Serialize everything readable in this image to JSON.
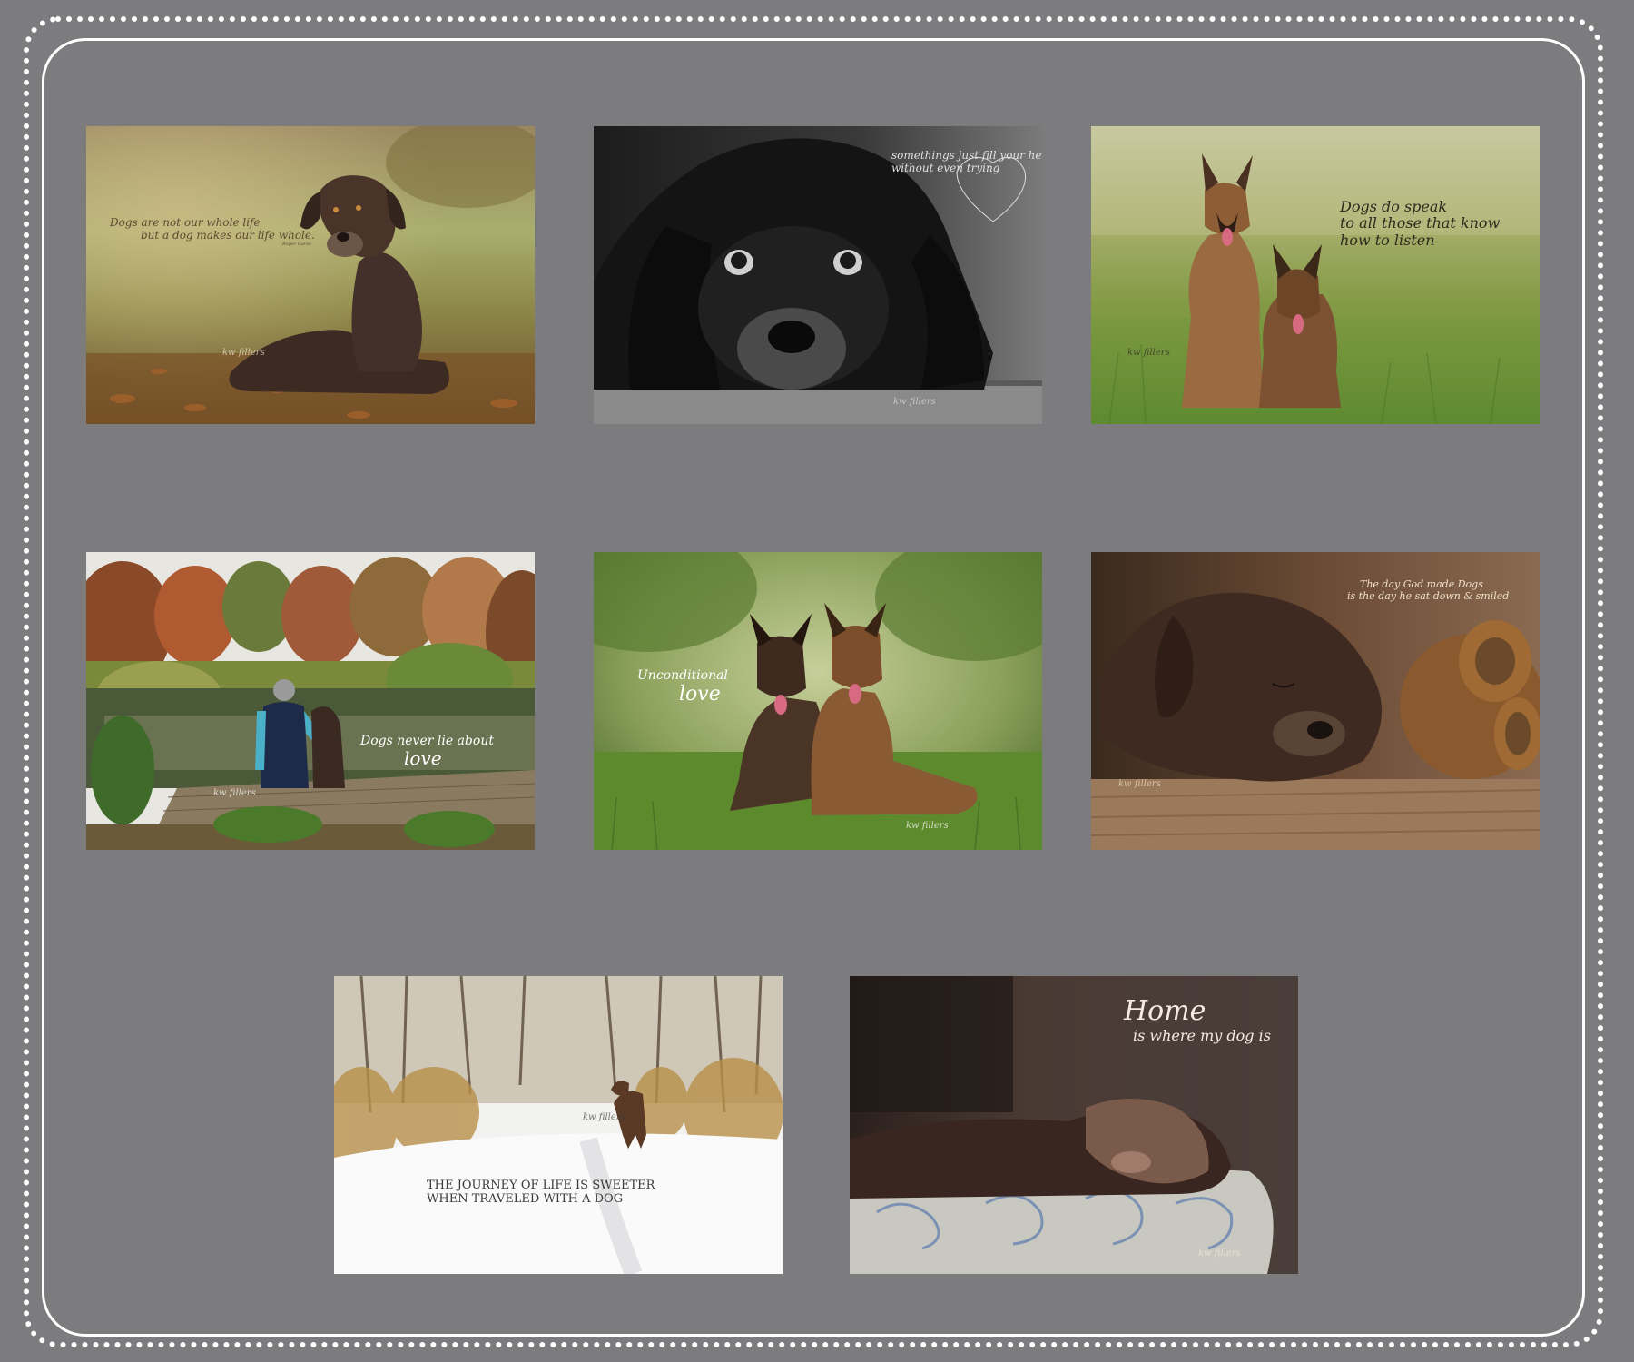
{
  "photos": [
    {
      "id": "labrador-autumn",
      "quote_lines": [
        "Dogs are not our whole life",
        "but a dog makes our life whole."
      ],
      "attribution": "Roger Caras",
      "watermark": "kw fillers"
    },
    {
      "id": "black-spaniel-bw",
      "quote_lines": [
        "somethings just fill your heart",
        "without even trying"
      ],
      "watermark": "kw fillers"
    },
    {
      "id": "two-malinois-field",
      "quote_lines": [
        "Dogs do speak",
        "to all those that know",
        "how to listen"
      ],
      "watermark": "kw fillers"
    },
    {
      "id": "person-dog-pond",
      "quote_lines": [
        "Dogs never lie about",
        "love"
      ],
      "watermark": "kw fillers"
    },
    {
      "id": "two-malinois-grass",
      "quote_lines": [
        "Unconditional",
        "love"
      ],
      "watermark": "kw fillers"
    },
    {
      "id": "lab-teddy-bear",
      "quote_lines": [
        "The day God made Dogs",
        "is the day he sat down & smiled"
      ],
      "watermark": "kw fillers"
    },
    {
      "id": "dog-snow-path",
      "quote_lines": [
        "THE JOURNEY OF LIFE IS SWEETER",
        "WHEN TRAVELED WITH A DOG"
      ],
      "watermark": "kw fillers"
    },
    {
      "id": "dog-sleeping-bed",
      "quote_lines": [
        "Home",
        "is where my dog is"
      ],
      "watermark": "kw fillers"
    }
  ],
  "colors": {
    "background": "#7c7c7e",
    "frame": "#ffffff"
  }
}
